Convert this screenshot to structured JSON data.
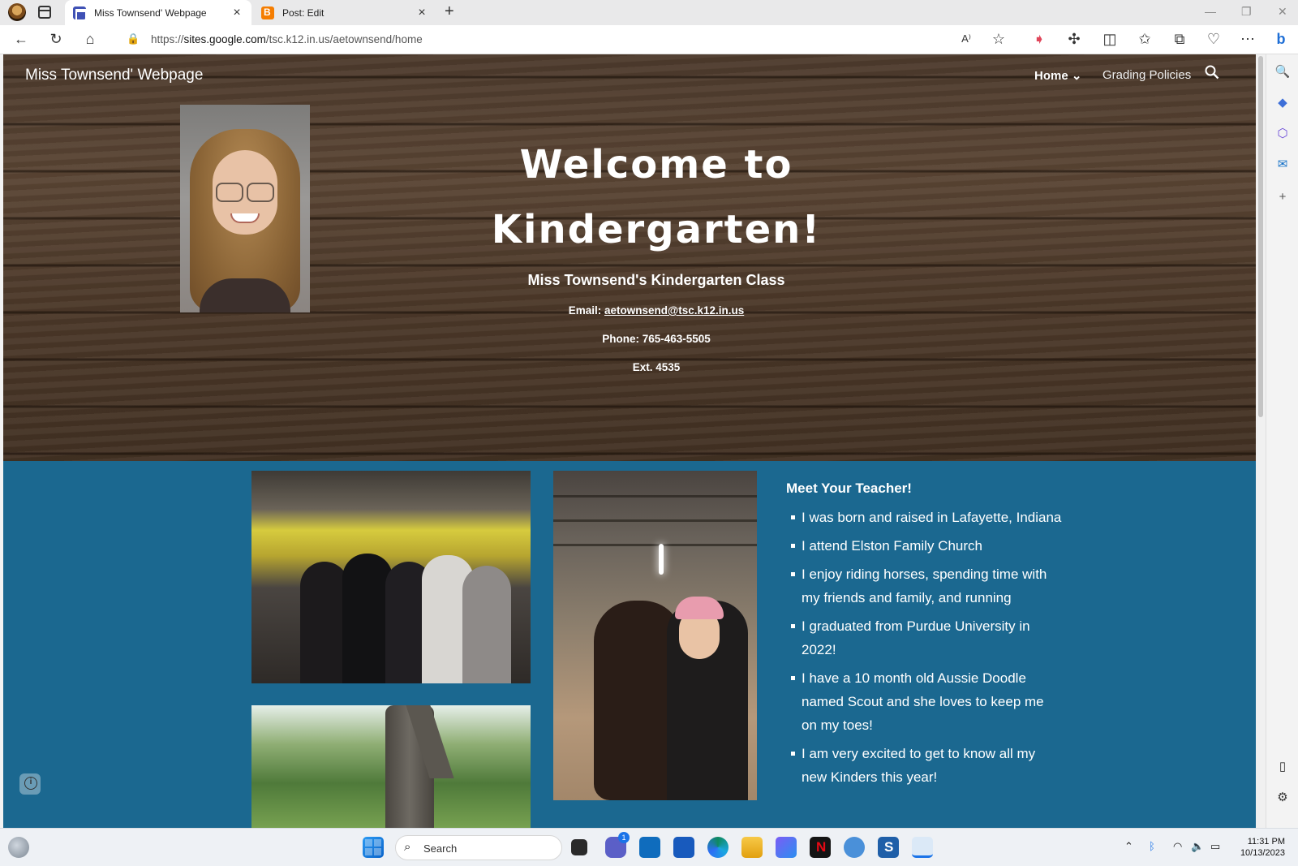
{
  "browser": {
    "tabs": [
      {
        "title": "Miss Townsend' Webpage",
        "active": true
      },
      {
        "title": "Post: Edit",
        "active": false
      }
    ],
    "url_domain": "sites.google.com",
    "url_prefix": "https://",
    "url_path": "/tsc.k12.in.us/aetownsend/home"
  },
  "site": {
    "title": "Miss Townsend' Webpage",
    "nav": {
      "home": "Home",
      "grading": "Grading Policies"
    }
  },
  "hero": {
    "welcome_line1": "Welcome to",
    "welcome_line2": "Kindergarten!",
    "class_name": "Miss Townsend's Kindergarten Class",
    "email_label": "Email: ",
    "email": "aetownsend@tsc.k12.in.us",
    "phone": "Phone: 765-463-5505",
    "ext": "Ext. 4535"
  },
  "teacher": {
    "heading": "Meet Your Teacher!",
    "facts": [
      "I was born and raised in Lafayette, Indiana",
      "I attend Elston Family Church",
      "I enjoy riding horses, spending time with my friends and family, and running",
      "I graduated from Purdue University in 2022!",
      "I have a 10 month old Aussie Doodle named Scout and she loves to keep me on my toes!",
      "I am very excited to get to know all my new Kinders this year!"
    ]
  },
  "taskbar": {
    "search_label": "Search",
    "teams_badge": "1",
    "time": "11:31 PM",
    "date": "10/13/2023"
  },
  "colors": {
    "section_bg": "#1b6890",
    "wood": "#5d4838"
  }
}
